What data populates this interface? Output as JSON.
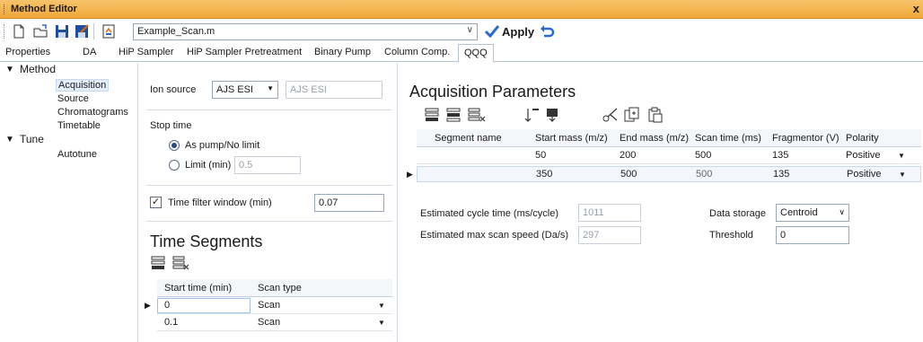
{
  "window": {
    "title": "Method Editor",
    "close_glyph": "x"
  },
  "toolbar": {
    "file_name": "Example_Scan.m",
    "apply_label": "Apply",
    "icons": [
      "new-file-icon",
      "open-file-icon",
      "save-icon",
      "save-as-icon",
      "report-icon",
      "undo-icon"
    ]
  },
  "tabs": [
    "Properties",
    "DA",
    "HiP Sampler",
    "HiP Sampler Pretreatment",
    "Binary Pump",
    "Column Comp.",
    "QQQ"
  ],
  "nav": {
    "method_label": "Method",
    "method_items": [
      "Acquisition",
      "Source",
      "Chromatograms",
      "Timetable"
    ],
    "tune_label": "Tune",
    "tune_items": [
      "Autotune"
    ],
    "selected": "Acquisition"
  },
  "left": {
    "ion_source_label": "Ion source",
    "ion_source_value": "AJS ESI",
    "ion_source_readonly": "AJS ESI",
    "stop_time_label": "Stop time",
    "as_pump_label": "As pump/No limit",
    "limit_label": "Limit (min)",
    "limit_value": "0.5",
    "time_filter_label": "Time filter window (min)",
    "time_filter_value": "0.07",
    "time_filter_checked": true,
    "time_segments_title": "Time Segments",
    "segments_columns": [
      "Start time (min)",
      "Scan type"
    ],
    "segments_rows": [
      {
        "start": "0",
        "type": "Scan"
      },
      {
        "start": "0.1",
        "type": "Scan"
      }
    ]
  },
  "right": {
    "title": "Acquisition Parameters",
    "columns": [
      "Segment name",
      "Start mass (m/z)",
      "End mass (m/z)",
      "Scan time (ms)",
      "Fragmentor (V)",
      "Polarity"
    ],
    "rows": [
      {
        "name": "",
        "start": "50",
        "end": "200",
        "scan": "500",
        "frag": "135",
        "polarity": "Positive"
      },
      {
        "name": "",
        "start": "350",
        "end": "500",
        "scan": "500",
        "frag": "135",
        "polarity": "Positive"
      }
    ],
    "cycle_time_label": "Estimated cycle time (ms/cycle)",
    "cycle_time_value": "1011",
    "scan_speed_label": "Estimated max scan speed (Da/s)",
    "scan_speed_value": "297",
    "data_storage_label": "Data storage",
    "data_storage_value": "Centroid",
    "threshold_label": "Threshold",
    "threshold_value": "0"
  },
  "colors": {
    "title_bar": "#f0a838",
    "accent_blue": "#2a6ad0",
    "apply_check": "#2a6ad0"
  }
}
